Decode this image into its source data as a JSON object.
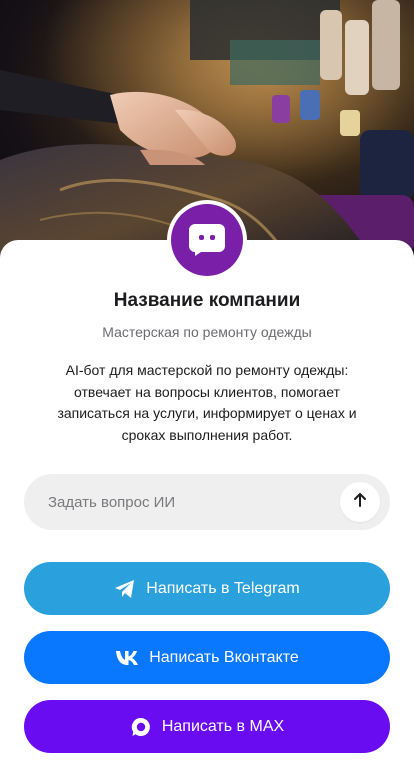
{
  "company": {
    "name": "Название компании",
    "subtitle": "Мастерская по ремонту одежды",
    "description": "AI-бот для мастерской по ремонту одежды: отвечает на вопросы клиентов, помогает записаться на услуги, информирует о ценах и сроках выполнения работ.",
    "avatar_icon": "chat-bot-icon",
    "avatar_color": "#7a1fa8"
  },
  "ask": {
    "placeholder": "Задать вопрос ИИ",
    "value": "",
    "send_icon": "arrow-up-icon"
  },
  "buttons": [
    {
      "label": "Написать в Telegram",
      "icon": "telegram-icon",
      "color": "#2aa0dc"
    },
    {
      "label": "Написать Вконтакте",
      "icon": "vk-icon",
      "color": "#0a77ff"
    },
    {
      "label": "Написать в MAX",
      "icon": "max-icon",
      "color": "#6a0cf2"
    }
  ]
}
